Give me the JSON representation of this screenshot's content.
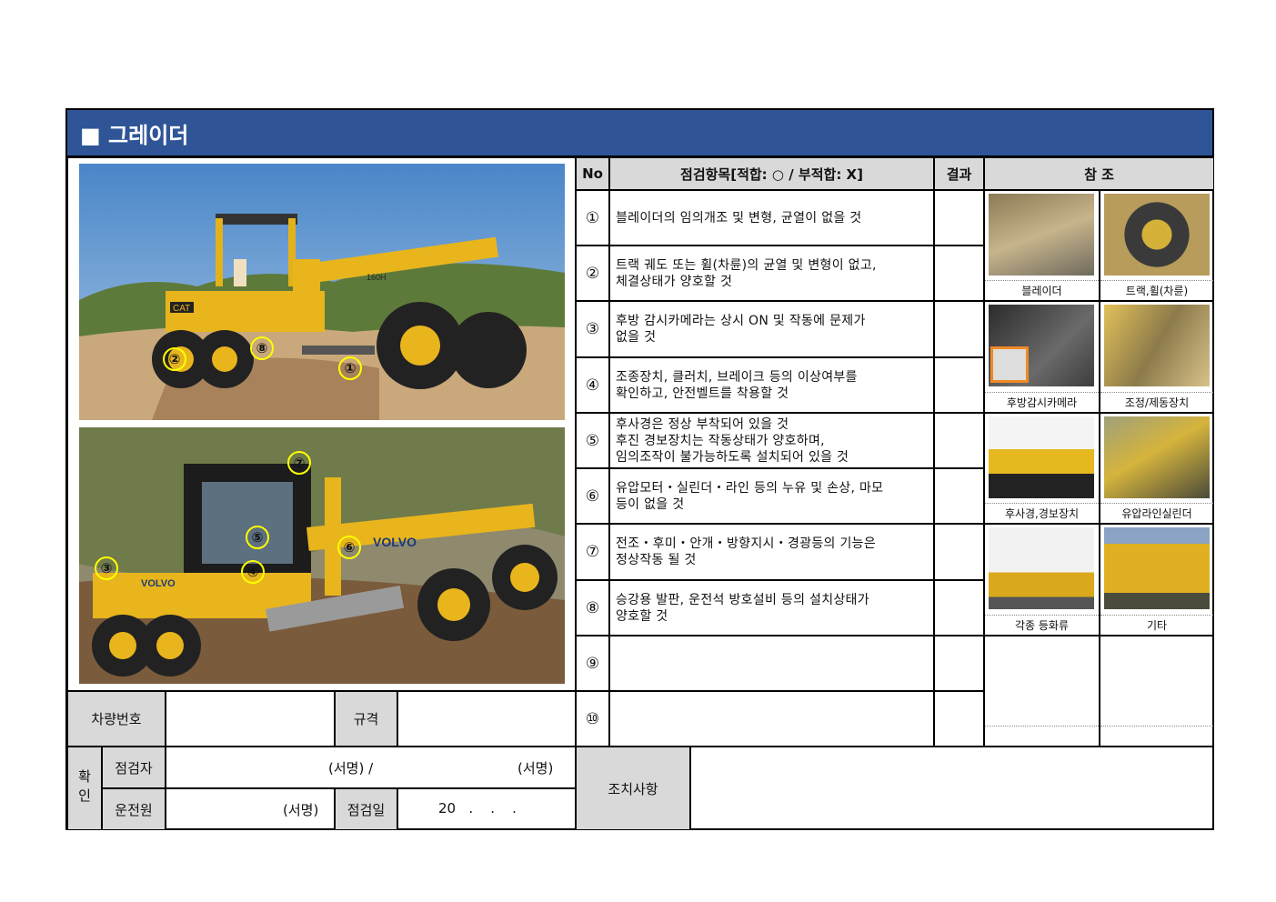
{
  "title": "■ 그레이더",
  "table": {
    "headers": {
      "no": "No",
      "item": "점검항목[적합: ○ / 부적합: X]",
      "result": "결과",
      "ref": "참 조"
    },
    "rows": [
      {
        "no": "①",
        "text": "블레이더의 임의개조 및 변형, 균열이 없을 것"
      },
      {
        "no": "②",
        "text": "트랙 궤도 또는 휠(차륜)의 균열 및 변형이 없고,\n체결상태가 양호할 것"
      },
      {
        "no": "③",
        "text": "후방 감시카메라는 상시 ON 및 작동에 문제가\n없을 것"
      },
      {
        "no": "④",
        "text": "조종장치, 클러치, 브레이크 등의 이상여부를\n확인하고, 안전벨트를 착용할 것"
      },
      {
        "no": "⑤",
        "text": "후사경은 정상 부착되어 있을 것\n후진 경보장치는 작동상태가 양호하며,\n임의조작이 불가능하도록 설치되어 있을 것"
      },
      {
        "no": "⑥",
        "text": "유압모터・실린더・라인 등의 누유 및 손상, 마모\n등이 없을 것"
      },
      {
        "no": "⑦",
        "text": "전조・후미・안개・방향지시・경광등의 기능은\n정상작동 될 것"
      },
      {
        "no": "⑧",
        "text": "승강용 발판, 운전석 방호설비 등의 설치상태가\n양호할 것"
      },
      {
        "no": "⑨",
        "text": ""
      },
      {
        "no": "⑩",
        "text": ""
      }
    ]
  },
  "reference_labels": [
    "블레이더",
    "트랙,휠(차륜)",
    "후방감시카메라",
    "조정/제동장치",
    "후사경,경보장치",
    "유압라인실린더",
    "각종 등화류",
    "기타"
  ],
  "photo_markers": {
    "top": [
      "①",
      "②",
      "⑧"
    ],
    "bottom": [
      "⑦",
      "⑤",
      "④",
      "③",
      "⑥"
    ]
  },
  "photo_text": {
    "top_brand": "CAT",
    "top_model": "160H",
    "bottom_brand": "VOLVO"
  },
  "footer": {
    "vehicle_no": "차량번호",
    "spec": "규격",
    "confirm": "확인",
    "inspector": "점검자",
    "driver": "운전원",
    "sign1": "(서명) /",
    "sign2": "(서명)",
    "sign3": "(서명)",
    "date_label": "점검일",
    "date_value": "20   .    .    .",
    "action": "조치사항"
  },
  "colors": {
    "title_bg": "#2f5597",
    "header_bg": "#d9d9d9",
    "marker": "#ffff00"
  }
}
